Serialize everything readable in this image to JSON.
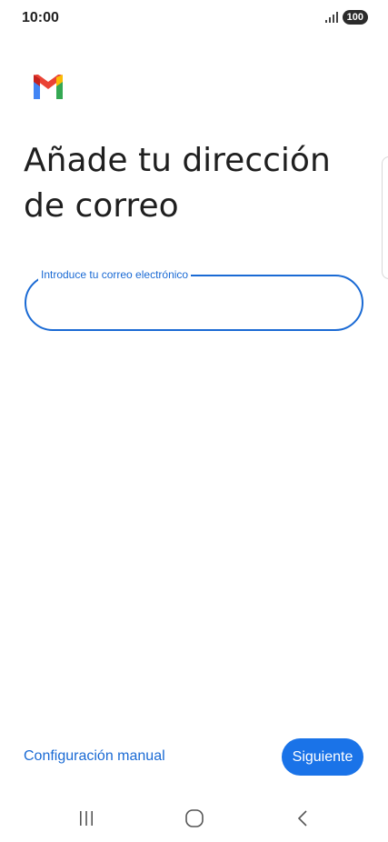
{
  "status_bar": {
    "time": "10:00",
    "battery": "100",
    "signal_icon": "signal-icon"
  },
  "logo": {
    "icon": "gmail-logo",
    "colors": {
      "red": "#ea4335",
      "blue": "#4285f4",
      "green": "#34a853",
      "yellow": "#fbbc04"
    }
  },
  "main": {
    "title": "Añade tu dirección de correo",
    "email_field": {
      "label": "Introduce tu correo electrónico",
      "value": ""
    }
  },
  "footer": {
    "manual_config_label": "Configuración manual",
    "next_label": "Siguiente"
  },
  "nav_bar": {
    "icons": [
      "recent-apps-icon",
      "home-icon",
      "back-icon"
    ]
  },
  "colors": {
    "accent": "#1a73e8",
    "field_border": "#1a6ad4",
    "text": "#1f1f1f"
  }
}
